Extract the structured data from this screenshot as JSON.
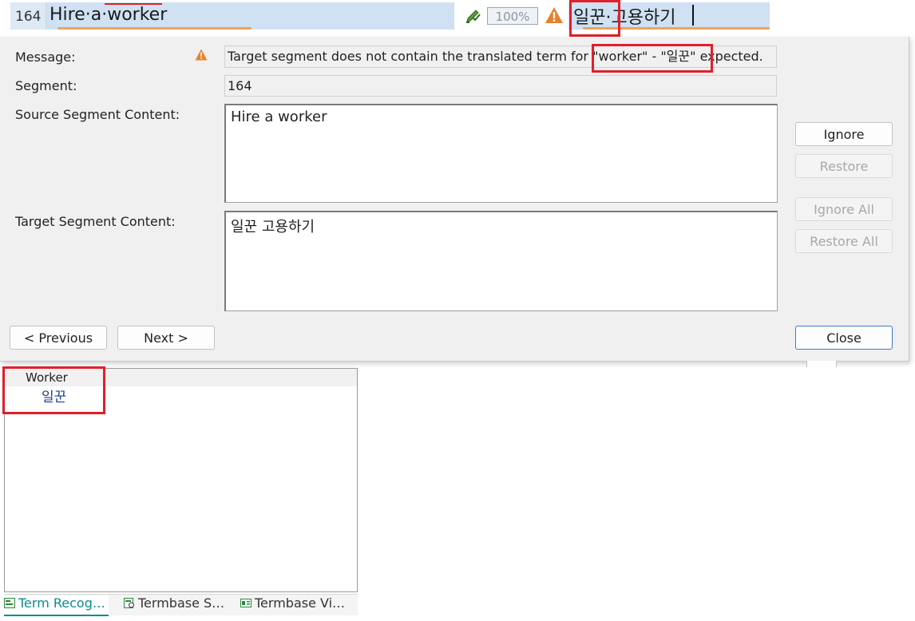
{
  "segment_row": {
    "number": "164",
    "source_text": "Hire·a·worker",
    "match_percent": "100%",
    "target_text": "일꾼·고용하기"
  },
  "dialog": {
    "labels": {
      "message": "Message:",
      "segment": "Segment:",
      "source_content": "Source Segment Content:",
      "target_content": "Target Segment Content:"
    },
    "message_text": "Target segment does not contain the translated term for \"worker\" - \"일꾼\" expected.",
    "segment_value": "164",
    "source_content": "Hire a worker",
    "target_content": "일꾼 고용하기",
    "buttons": {
      "ignore": "Ignore",
      "restore": "Restore",
      "ignore_all": "Ignore All",
      "restore_all": "Restore All",
      "previous": "< Previous",
      "next": "Next >",
      "close": "Close"
    }
  },
  "term_panel": {
    "source_term": "Worker",
    "target_term": "일꾼",
    "tabs": [
      "Term Recog…",
      "Termbase S…",
      "Termbase Vi…"
    ]
  },
  "colors": {
    "selection_blue": "#cfe1f3",
    "warning_orange": "#e8822a",
    "highlight_red": "#e0202a",
    "active_tab_teal": "#0e8a8f"
  },
  "icons": {
    "pencil": "pencil-check-icon",
    "warning": "warning-triangle-icon",
    "term": "term-recognition-icon",
    "termbase_search": "termbase-search-icon",
    "termbase_viewer": "termbase-viewer-icon"
  }
}
